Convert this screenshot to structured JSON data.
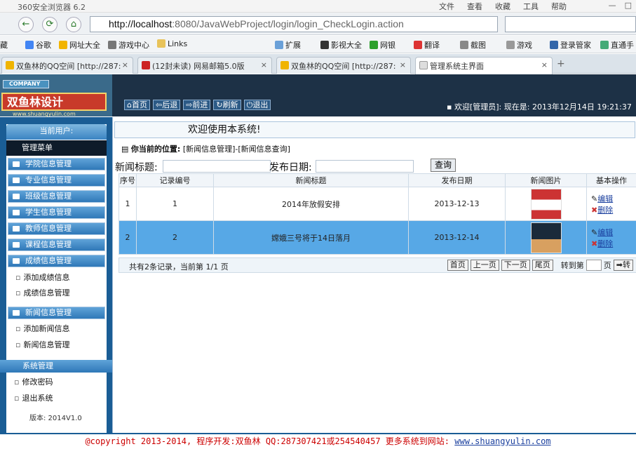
{
  "browser": {
    "title": "360安全浏览器 6.2",
    "menus": [
      "文件",
      "查看",
      "收藏",
      "工具",
      "帮助"
    ],
    "url_host": "http://localhost",
    "url_rest": ":8080/JavaWebProject/login/login_CheckLogin.action",
    "bookmarks": [
      "藏",
      "谷歌",
      "网址大全",
      "游戏中心",
      "Links",
      "扩展",
      "影视大全",
      "网银",
      "翻译",
      "截图",
      "游戏",
      "登录管家",
      "直通手"
    ],
    "tabs": [
      {
        "label": "双鱼林的QQ空间 [http://287:",
        "active": false
      },
      {
        "label": "(12封未读) 网易邮箱5.0版",
        "active": false
      },
      {
        "label": "双鱼林的QQ空间 [http://287:",
        "active": false
      },
      {
        "label": "管理系统主界面",
        "active": true
      }
    ]
  },
  "header": {
    "company": "COMPANY",
    "logo": "双鱼林设计",
    "logo_url": "www.shuangyulin.com",
    "nav": [
      "首页",
      "后退",
      "前进",
      "刷新",
      "退出"
    ],
    "welcome": "欢迎[管理员]: 现在是: 2013年12月14日 19:21:37"
  },
  "sidebar": {
    "current_user": "当前用户:",
    "menu_title": "管理菜单",
    "items": [
      "学院信息管理",
      "专业信息管理",
      "班级信息管理",
      "学生信息管理",
      "教师信息管理",
      "课程信息管理",
      "成绩信息管理"
    ],
    "score_subs": [
      "添加成绩信息",
      "成绩信息管理"
    ],
    "news_title": "新闻信息管理",
    "news_subs": [
      "添加新闻信息",
      "新闻信息管理"
    ],
    "system_title": "系统管理",
    "system_subs": [
      "修改密码",
      "退出系统"
    ],
    "version": "版本: 2014V1.0"
  },
  "main": {
    "welcome": "欢迎使用本系统!",
    "location_label": "你当前的位置:",
    "location": "[新闻信息管理]-[新闻信息查询]",
    "search_title_label": "新闻标题:",
    "search_date_label": "发布日期:",
    "search_button": "查询",
    "columns": [
      "序号",
      "记录编号",
      "新闻标题",
      "发布日期",
      "新闻图片",
      "基本操作"
    ],
    "rows": [
      {
        "no": "1",
        "id": "1",
        "title": "2014年放假安排",
        "date": "2013-12-13",
        "edit": "编辑",
        "del": "删除"
      },
      {
        "no": "2",
        "id": "2",
        "title": "嫦娥三号将于14日落月",
        "date": "2013-12-14",
        "edit": "编辑",
        "del": "删除"
      }
    ],
    "pager_info": "共有2条记录，当前第 1/1 页",
    "pager_buttons": [
      "首页",
      "上一页",
      "下一页",
      "尾页"
    ],
    "goto_label": "转到第",
    "page_unit": "页",
    "goto_button": "转"
  },
  "footer": {
    "text": "@copyright 2013-2014, 程序开发:双鱼林  QQ:287307421或254540457  更多系统到网站: ",
    "link": "www.shuangyulin.com"
  }
}
